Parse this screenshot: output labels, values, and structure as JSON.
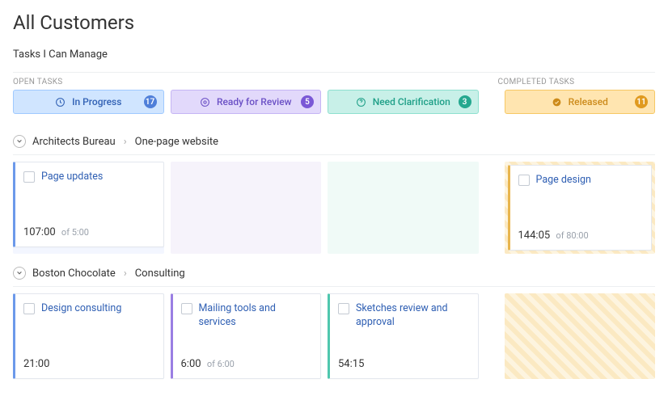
{
  "page_title": "All Customers",
  "subtitle": "Tasks I Can Manage",
  "section_labels": {
    "open": "OPEN TASKS",
    "completed": "COMPLETED TASKS"
  },
  "columns": {
    "in_progress": {
      "label": "In Progress",
      "count": "17"
    },
    "review": {
      "label": "Ready for Review",
      "count": "5"
    },
    "clarify": {
      "label": "Need Clarification",
      "count": "3"
    },
    "released": {
      "label": "Released",
      "count": "11"
    }
  },
  "groups": [
    {
      "customer": "Architects Bureau",
      "project": "One-page website",
      "cards": {
        "in_progress": {
          "title": "Page updates",
          "time": "107:00",
          "of": "of 5:00"
        },
        "review": null,
        "clarify": null,
        "released": {
          "title": "Page design",
          "time": "144:05",
          "of": "of 80:00"
        }
      }
    },
    {
      "customer": "Boston Chocolate",
      "project": "Consulting",
      "cards": {
        "in_progress": {
          "title": "Design consulting",
          "time": "21:00",
          "of": ""
        },
        "review": {
          "title": "Mailing tools and services",
          "time": "6:00",
          "of": "of 6:00"
        },
        "clarify": {
          "title": "Sketches review and approval",
          "time": "54:15",
          "of": ""
        },
        "released": null
      }
    }
  ]
}
